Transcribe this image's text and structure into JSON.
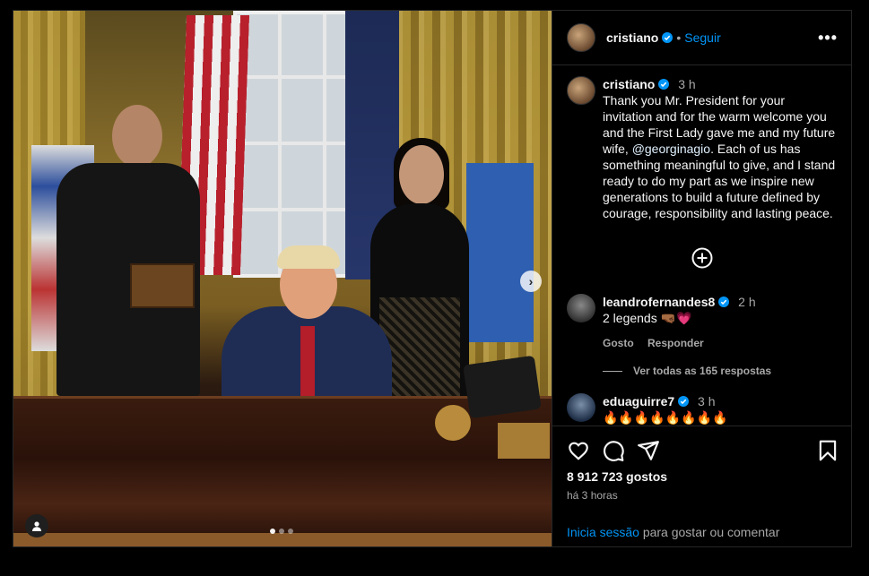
{
  "post": {
    "author": "cristiano",
    "follow_label": "Seguir",
    "separator": "•",
    "more_label": "•••"
  },
  "caption": {
    "author": "cristiano",
    "time": "3 h",
    "text_before": "Thank you Mr. President for your invitation and for the warm welcome you and the First Lady gave me and my future wife, ",
    "mention": "@georginagio",
    "text_after": ". Each of us has something meaningful to give, and I stand ready to do my part as we inspire new generations to build a future defined by courage, responsibility and lasting peace."
  },
  "comments": [
    {
      "author": "leandrofernandes8",
      "time": "2 h",
      "text": "2 legends 🤜🏾💗",
      "like_label": "Gosto",
      "reply_label": "Responder"
    },
    {
      "author": "eduaguirre7",
      "time": "3 h",
      "text": "🔥🔥🔥🔥🔥🔥🔥🔥"
    }
  ],
  "replies_label": "Ver todas as 165 respostas",
  "likes": "8 912 723 gostos",
  "posted_ago": "há 3 horas",
  "login": {
    "link": "Inicia sessão",
    "rest": " para gostar ou comentar"
  },
  "carousel": {
    "next_label": "›",
    "slides": 3,
    "active_index": 0
  },
  "colors": {
    "accent": "#0095f6",
    "background": "#000000",
    "text": "#f5f5f5",
    "muted": "#a8a8a8",
    "border": "#262626",
    "verified": "#0095f6"
  },
  "icons": [
    "verified-icon",
    "add-icon",
    "heart-icon",
    "comment-icon",
    "share-icon",
    "bookmark-icon",
    "user-tag-icon",
    "chevron-right-icon"
  ]
}
